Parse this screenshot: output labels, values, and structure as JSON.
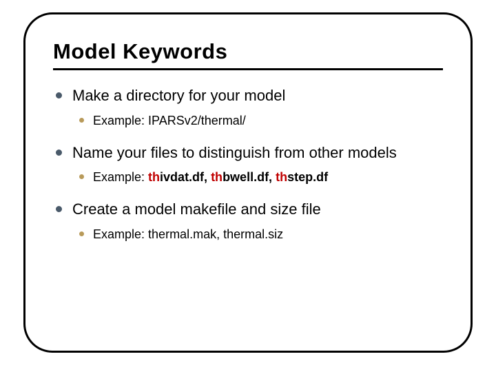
{
  "title": "Model Keywords",
  "items": [
    {
      "text": "Make a directory for your model",
      "sub": {
        "prefix": "Example: ",
        "plain": "IPARSv2/thermal/"
      }
    },
    {
      "text": "Name your files to distinguish from other models",
      "sub": {
        "prefix": "Example: ",
        "parts": [
          {
            "hl": "th",
            "rest": "ivdat.df, "
          },
          {
            "hl": "th",
            "rest": "bwell.df, "
          },
          {
            "hl": "th",
            "rest": "step.df"
          }
        ]
      }
    },
    {
      "text": "Create a model makefile and size file",
      "sub": {
        "prefix": "Example: ",
        "plain": "thermal.mak, thermal.siz"
      }
    }
  ]
}
